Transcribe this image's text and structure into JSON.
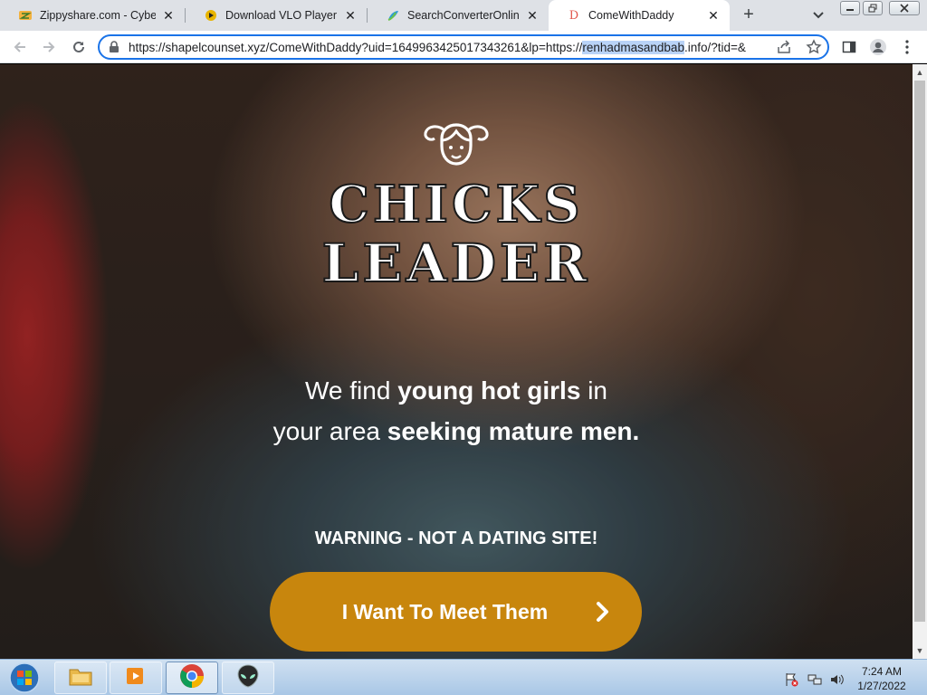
{
  "browser": {
    "tabs": [
      {
        "title": "Zippyshare.com - CyberS",
        "favicon": "zippyshare-icon"
      },
      {
        "title": "Download VLO Player",
        "favicon": "vlo-player-icon"
      },
      {
        "title": "SearchConverterOnline",
        "favicon": "search-converter-icon"
      },
      {
        "title": "ComeWithDaddy",
        "favicon": "d-letter-icon",
        "active": true
      }
    ],
    "url": {
      "before_selection": "https://shapelcounset.xyz/ComeWithDaddy?uid=1649963425017343261&lp=https://",
      "selection": "renhadmasandbab",
      "after_selection": ".info/?tid=&"
    }
  },
  "page": {
    "logo": {
      "line1": "CHICKS",
      "line2": "LEADER"
    },
    "headline": {
      "line1_part1": "We find ",
      "line1_bold": "young hot girls",
      "line1_part2": " in",
      "line2_part1": "your area ",
      "line2_bold": "seeking mature men."
    },
    "warning": "WARNING - NOT A DATING SITE!",
    "cta_label": "I Want To Meet Them",
    "accent_color": "#c8860d"
  },
  "taskbar": {
    "apps": [
      "explorer-icon",
      "media-player-icon",
      "chrome-icon",
      "alien-icon"
    ],
    "clock": {
      "time": "7:24 AM",
      "date": "1/27/2022"
    }
  }
}
